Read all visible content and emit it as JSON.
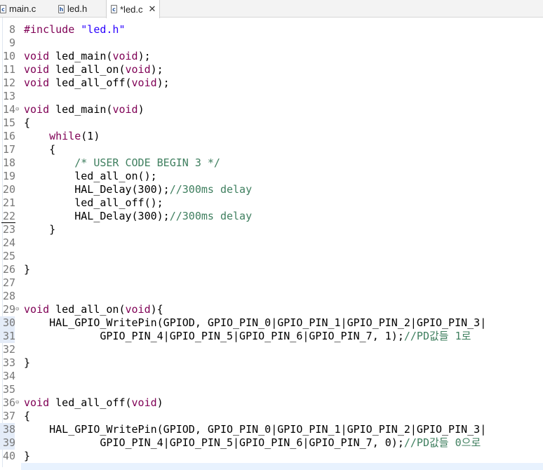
{
  "tabs": [
    {
      "label": "main.c",
      "icon": "c-source-file-icon",
      "glyph": "c"
    },
    {
      "label": "led.h",
      "icon": "c-header-file-icon",
      "glyph": "h"
    },
    {
      "label": "*led.c",
      "icon": "c-source-file-icon",
      "glyph": "c",
      "active": true
    }
  ],
  "lines": [
    {
      "n": "8",
      "code": "<span class=\"kw\">#include</span> <span class=\"str\">\"led.h\"</span>"
    },
    {
      "n": "9",
      "code": ""
    },
    {
      "n": "10",
      "code": "<span class=\"kw\">void</span> led_main(<span class=\"kw\">void</span>);"
    },
    {
      "n": "11",
      "code": "<span class=\"kw\">void</span> led_all_on(<span class=\"kw\">void</span>);"
    },
    {
      "n": "12",
      "code": "<span class=\"kw\">void</span> led_all_off(<span class=\"kw\">void</span>);"
    },
    {
      "n": "13",
      "code": ""
    },
    {
      "n": "14",
      "fold": true,
      "code": "<span class=\"kw\">void</span> led_main(<span class=\"kw\">void</span>)"
    },
    {
      "n": "15",
      "code": "{"
    },
    {
      "n": "16",
      "code": "    <span class=\"kw\">while</span>(1)"
    },
    {
      "n": "17",
      "code": "    {"
    },
    {
      "n": "18",
      "code": "        <span class=\"cm\">/* USER CODE BEGIN 3 */</span>"
    },
    {
      "n": "19",
      "code": "        led_all_on();"
    },
    {
      "n": "20",
      "code": "        HAL_Delay(300);<span class=\"cm\">//300ms delay</span>"
    },
    {
      "n": "21",
      "code": "        led_all_off();"
    },
    {
      "n": "22",
      "code": "        HAL_Delay(300);<span class=\"cm\">//300ms delay</span>"
    },
    {
      "n": "23",
      "code": "    }"
    },
    {
      "n": "24",
      "code": ""
    },
    {
      "n": "25",
      "code": ""
    },
    {
      "n": "26",
      "code": "}"
    },
    {
      "n": "27",
      "code": ""
    },
    {
      "n": "28",
      "code": ""
    },
    {
      "n": "29",
      "fold": true,
      "code": "<span class=\"kw\">void</span> led_all_on(<span class=\"kw\">void</span>){"
    },
    {
      "n": "30",
      "ruler": true,
      "code": "    HAL_GPIO_WritePin(GPIOD, GPIO_PIN_0|GPIO_PIN_1|GPIO_PIN_2|GPIO_PIN_3|"
    },
    {
      "n": "31",
      "ruler": true,
      "code": "            GPIO_PIN_4|GPIO_PIN_5|GPIO_PIN_6|GPIO_PIN_7, 1);<span class=\"cm\">//PD값들 1로</span>"
    },
    {
      "n": "32",
      "code": ""
    },
    {
      "n": "33",
      "code": "}"
    },
    {
      "n": "34",
      "code": ""
    },
    {
      "n": "35",
      "code": ""
    },
    {
      "n": "36",
      "fold": true,
      "code": "<span class=\"kw\">void</span> led_all_off(<span class=\"kw\">void</span>)"
    },
    {
      "n": "37",
      "code": "{"
    },
    {
      "n": "38",
      "ruler": true,
      "code": "    HAL_GPIO_WritePin(GPIOD, GPIO_PIN_0|GPIO_PIN_1|GPIO_PIN_2|GPIO_PIN_3|"
    },
    {
      "n": "39",
      "ruler": true,
      "code": "            GPIO_PIN_4|GPIO_PIN_5|GPIO_PIN_6|GPIO_PIN_7, 0);<span class=\"cm\">//PD값들 0으로</span>"
    },
    {
      "n": "40",
      "code": "}"
    }
  ],
  "colors": {
    "keyword": "#7f0055",
    "string": "#2a00ff",
    "comment": "#3f7f5f",
    "lineNumber": "#787878"
  }
}
